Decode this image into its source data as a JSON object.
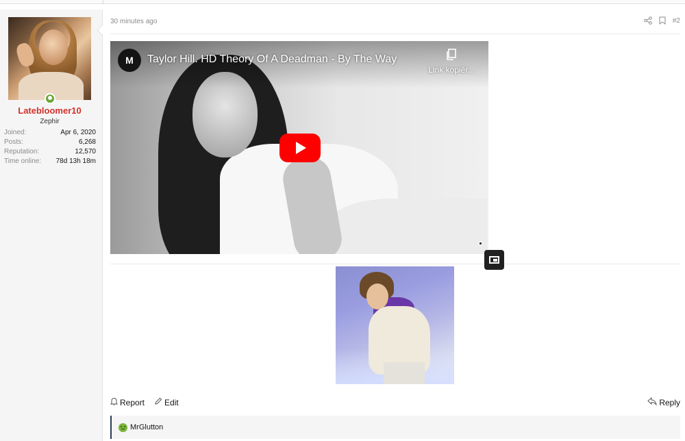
{
  "user": {
    "name": "Latebloomer10",
    "title": "Zephir",
    "stats": [
      {
        "label": "Joined:",
        "value": "Apr 6, 2020"
      },
      {
        "label": "Posts:",
        "value": "6,268"
      },
      {
        "label": "Reputation:",
        "value": "12,570"
      },
      {
        "label": "Time online:",
        "value": "78d 13h 18m"
      }
    ]
  },
  "post": {
    "time": "30 minutes ago",
    "number": "#2",
    "video": {
      "channel_initial": "M",
      "title": "Taylor Hill. HD Theory Of A Deadman - By The Way",
      "copy_link_label": "Link kopiër..."
    },
    "actions": {
      "report": "Report",
      "edit": "Edit",
      "reply": "Reply"
    },
    "reactions": {
      "user": "MrGlutton"
    }
  },
  "colors": {
    "username": "#d1312b",
    "online": "#67a536",
    "play_button": "#ff0000",
    "reaction": "#79b53a"
  }
}
